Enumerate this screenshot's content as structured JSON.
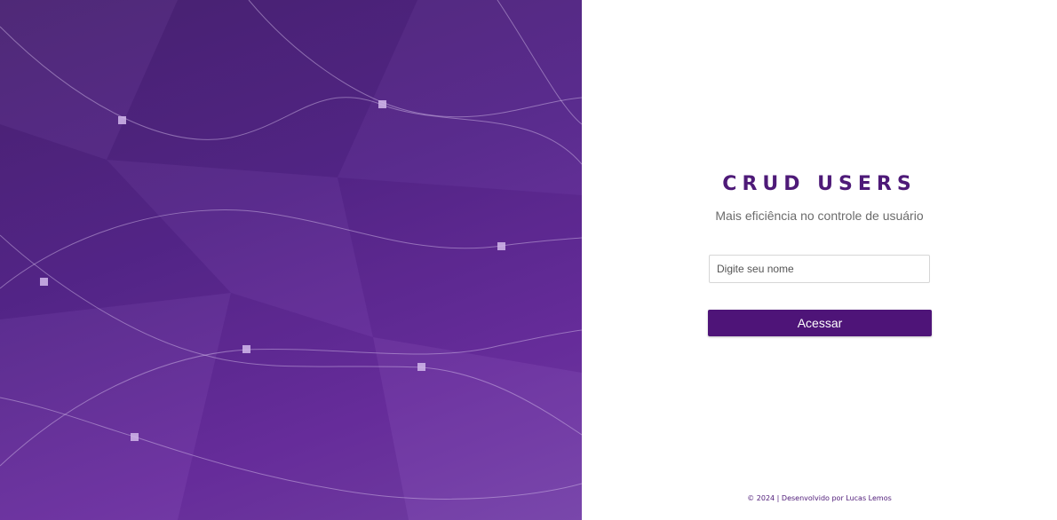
{
  "login": {
    "title": "CRUD USERS",
    "subtitle": "Mais eficiência no controle de usuário",
    "name_input": {
      "value": "",
      "placeholder": "Digite seu nome"
    },
    "access_label": "Acessar"
  },
  "footer": {
    "text": "© 2024 | Desenvolvido por Lucas Lemos"
  },
  "colors": {
    "brand_purple": "#4e1478",
    "hero_gradient_start": "#4a2373",
    "hero_gradient_end": "#7440a8"
  }
}
